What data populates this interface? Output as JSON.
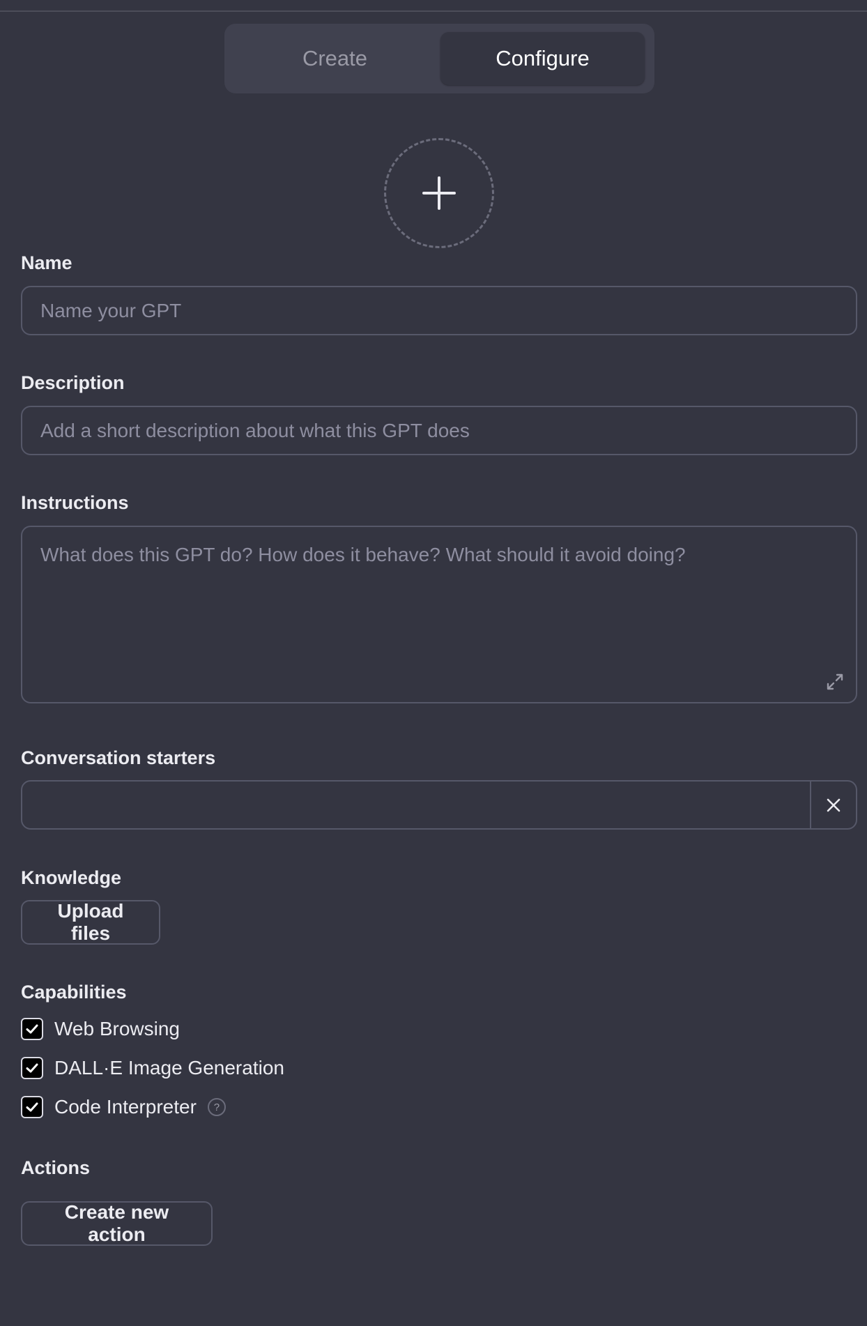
{
  "tabs": [
    {
      "label": "Create",
      "active": false
    },
    {
      "label": "Configure",
      "active": true
    }
  ],
  "avatar": {
    "icon": "plus-icon"
  },
  "name": {
    "label": "Name",
    "value": "",
    "placeholder": "Name your GPT"
  },
  "description": {
    "label": "Description",
    "value": "",
    "placeholder": "Add a short description about what this GPT does"
  },
  "instructions": {
    "label": "Instructions",
    "value": "",
    "placeholder": "What does this GPT do? How does it behave? What should it avoid doing?",
    "expand_icon": "expand-icon"
  },
  "conversation_starters": {
    "label": "Conversation starters",
    "items": [
      {
        "value": ""
      }
    ],
    "remove_icon": "close-icon"
  },
  "knowledge": {
    "label": "Knowledge",
    "upload_label": "Upload files"
  },
  "capabilities": {
    "label": "Capabilities",
    "items": [
      {
        "label": "Web Browsing",
        "checked": true
      },
      {
        "label": "DALL·E Image Generation",
        "checked": true
      },
      {
        "label": "Code Interpreter",
        "checked": true,
        "help": "?"
      }
    ]
  },
  "actions": {
    "label": "Actions",
    "create_label": "Create new action"
  },
  "colors": {
    "background": "#343541",
    "surface": "#40414f",
    "border": "#565869",
    "text": "#ececf1",
    "placeholder": "#8e8ea0"
  }
}
